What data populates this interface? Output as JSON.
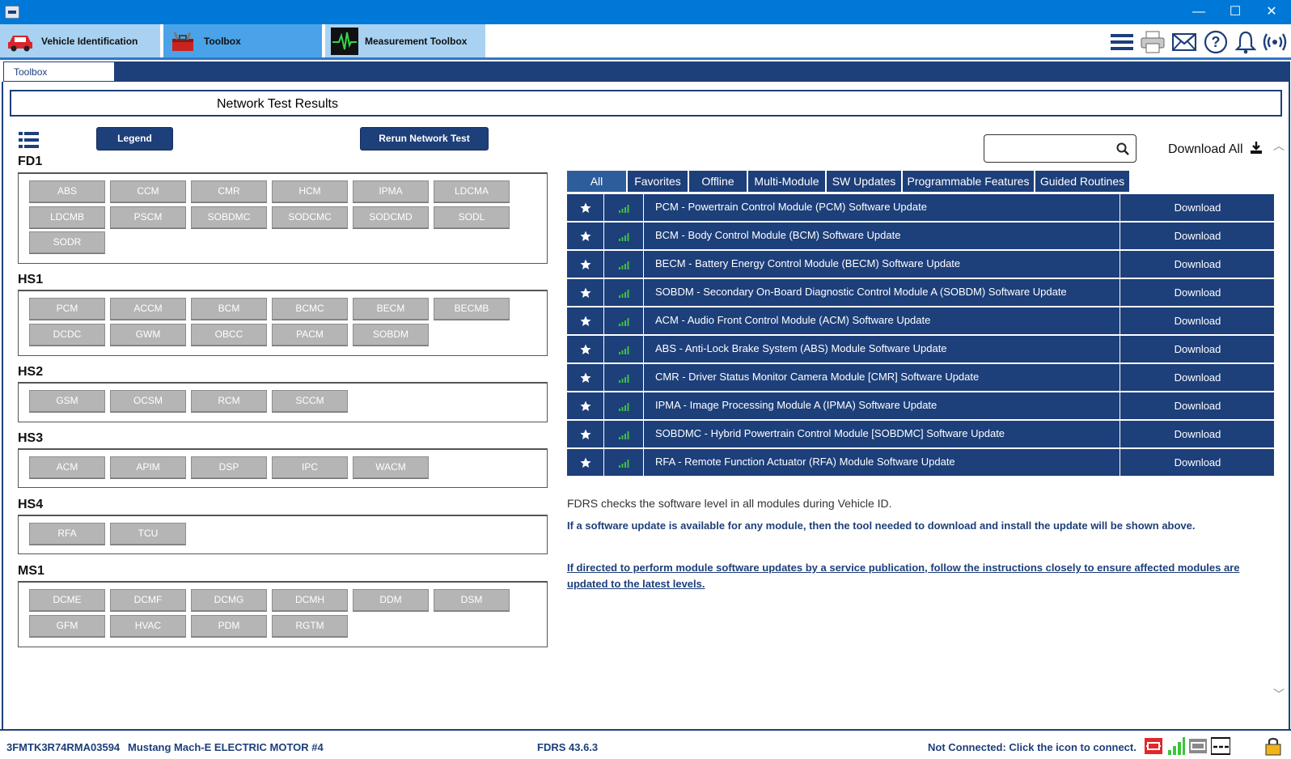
{
  "window": {
    "minimize": "—",
    "maximize": "☐",
    "close": "✕"
  },
  "app_tabs": [
    {
      "label": "Vehicle Identification"
    },
    {
      "label": "Toolbox"
    },
    {
      "label": "Measurement Toolbox"
    }
  ],
  "subtab": {
    "label": "Toolbox"
  },
  "page_title": "Network Test Results",
  "buttons": {
    "legend": "Legend",
    "rerun": "Rerun Network Test"
  },
  "networks": [
    {
      "name": "FD1",
      "modules": [
        "ABS",
        "CCM",
        "CMR",
        "HCM",
        "IPMA",
        "LDCMA",
        "LDCMB",
        "PSCM",
        "SOBDMC",
        "SODCMC",
        "SODCMD",
        "SODL",
        "SODR"
      ]
    },
    {
      "name": "HS1",
      "modules": [
        "PCM",
        "ACCM",
        "BCM",
        "BCMC",
        "BECM",
        "BECMB",
        "DCDC",
        "GWM",
        "OBCC",
        "PACM",
        "SOBDM"
      ]
    },
    {
      "name": "HS2",
      "modules": [
        "GSM",
        "OCSM",
        "RCM",
        "SCCM"
      ]
    },
    {
      "name": "HS3",
      "modules": [
        "ACM",
        "APIM",
        "DSP",
        "IPC",
        "WACM"
      ]
    },
    {
      "name": "HS4",
      "modules": [
        "RFA",
        "TCU"
      ]
    },
    {
      "name": "MS1",
      "modules": [
        "DCME",
        "DCMF",
        "DCMG",
        "DCMH",
        "DDM",
        "DSM",
        "GFM",
        "HVAC",
        "PDM",
        "RGTM"
      ]
    }
  ],
  "search": {
    "placeholder": ""
  },
  "download_all": "Download All",
  "filter_tabs": [
    "All",
    "Favorites",
    "Offline",
    "Multi-Module",
    "SW Updates",
    "Programmable Features",
    "Guided Routines"
  ],
  "updates": [
    {
      "name": "PCM - Powertrain Control Module (PCM) Software Update",
      "action": "Download"
    },
    {
      "name": "BCM - Body Control Module (BCM) Software Update",
      "action": "Download"
    },
    {
      "name": "BECM - Battery Energy Control Module (BECM) Software Update",
      "action": "Download"
    },
    {
      "name": "SOBDM - Secondary On-Board Diagnostic Control Module A (SOBDM) Software Update",
      "action": "Download"
    },
    {
      "name": "ACM - Audio Front Control Module (ACM) Software Update",
      "action": "Download"
    },
    {
      "name": "ABS - Anti-Lock Brake System (ABS) Module Software Update",
      "action": "Download"
    },
    {
      "name": "CMR - Driver Status Monitor Camera Module [CMR] Software Update",
      "action": "Download"
    },
    {
      "name": "IPMA - Image Processing Module A (IPMA) Software Update",
      "action": "Download"
    },
    {
      "name": "SOBDMC - Hybrid Powertrain Control Module [SOBDMC] Software Update",
      "action": "Download"
    },
    {
      "name": "RFA - Remote Function Actuator (RFA) Module Software Update",
      "action": "Download"
    }
  ],
  "info": {
    "line1": "FDRS checks the software level in all modules during Vehicle ID.",
    "line2": "If a software update is available for any module, then the tool needed to download and install the update will be shown above.",
    "line3": "If directed to perform module software updates by a service publication, follow the instructions closely to ensure affected modules are updated to the latest levels."
  },
  "status": {
    "vin": "3FMTK3R74RMA03594",
    "vehicle": "Mustang Mach-E ELECTRIC MOTOR #4",
    "version": "FDRS 43.6.3",
    "connection": "Not Connected: Click the icon to connect."
  },
  "colors": {
    "navy": "#1d3f7a",
    "titlebar": "#0078d7",
    "module_gray": "#b5b5b5",
    "signal_green": "#3cc43c"
  }
}
